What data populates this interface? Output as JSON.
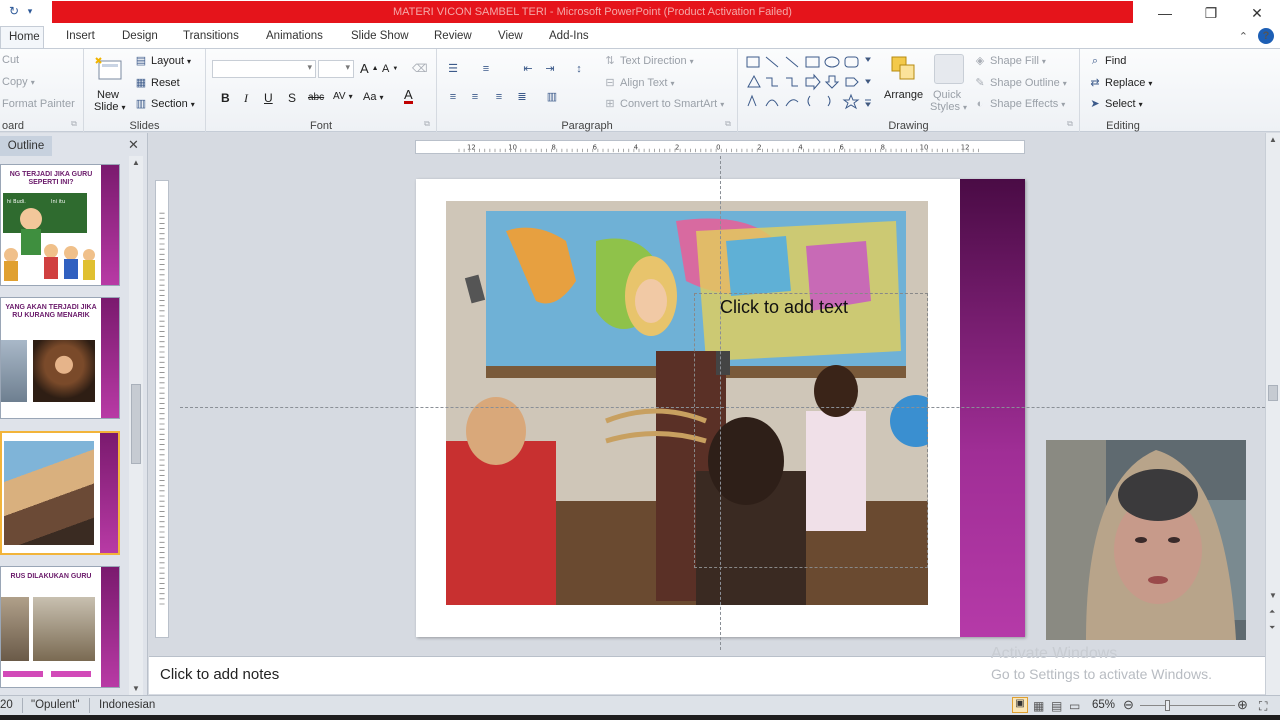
{
  "window": {
    "title": "MATERI VICON SAMBEL TERI  -  Microsoft PowerPoint (Product Activation Failed)",
    "controls": [
      "—",
      "❐",
      "✕"
    ]
  },
  "tabs": [
    "Home",
    "Insert",
    "Design",
    "Transitions",
    "Animations",
    "Slide Show",
    "Review",
    "View",
    "Add-Ins"
  ],
  "active_tab": "Home",
  "ribbon": {
    "clipboard": {
      "cut": "Cut",
      "copy": "Copy",
      "format_painter": "Format Painter",
      "label": "oard"
    },
    "slides": {
      "new_slide": "New",
      "new_slide2": "Slide",
      "layout": "Layout",
      "reset": "Reset",
      "section": "Section",
      "label": "Slides"
    },
    "font": {
      "label": "Font",
      "bold": "B",
      "italic": "I",
      "underline": "U",
      "shadow": "S",
      "strike": "abc",
      "spacing": "AV",
      "case": "Aa",
      "color": "A",
      "grow": "A",
      "shrink": "A"
    },
    "paragraph": {
      "text_direction": "Text Direction",
      "align_text": "Align Text",
      "convert_smartart": "Convert to SmartArt",
      "label": "Paragraph"
    },
    "drawing": {
      "arrange": "Arrange",
      "quick_styles": "Quick",
      "quick_styles2": "Styles",
      "shape_fill": "Shape Fill",
      "shape_outline": "Shape Outline",
      "shape_effects": "Shape Effects",
      "label": "Drawing"
    },
    "editing": {
      "find": "Find",
      "replace": "Replace",
      "select": "Select",
      "label": "Editing"
    }
  },
  "left_panel": {
    "tab": "Outline",
    "thumbs": [
      {
        "caption": "NG TERJADI JIKA GURU SEPERTI INI?"
      },
      {
        "caption": "YANG AKAN TERJADI JIKA RU KURANG MENARIK"
      },
      {
        "caption": ""
      },
      {
        "caption": "RUS DILAKUKAN GURU"
      }
    ]
  },
  "ruler": {
    "h_ticks": [
      "12",
      "10",
      "8",
      "6",
      "4",
      "2",
      "0",
      "2",
      "4",
      "6",
      "8",
      "10",
      "12"
    ]
  },
  "slide": {
    "placeholder": "Click to add text"
  },
  "notes": {
    "placeholder": "Click to add notes"
  },
  "watermark": {
    "line1": "Activate Windows",
    "line2": "Go to Settings to activate Windows."
  },
  "status": {
    "slide": "20",
    "theme": "\"Opulent\"",
    "language": "Indonesian",
    "zoom": "65%"
  }
}
